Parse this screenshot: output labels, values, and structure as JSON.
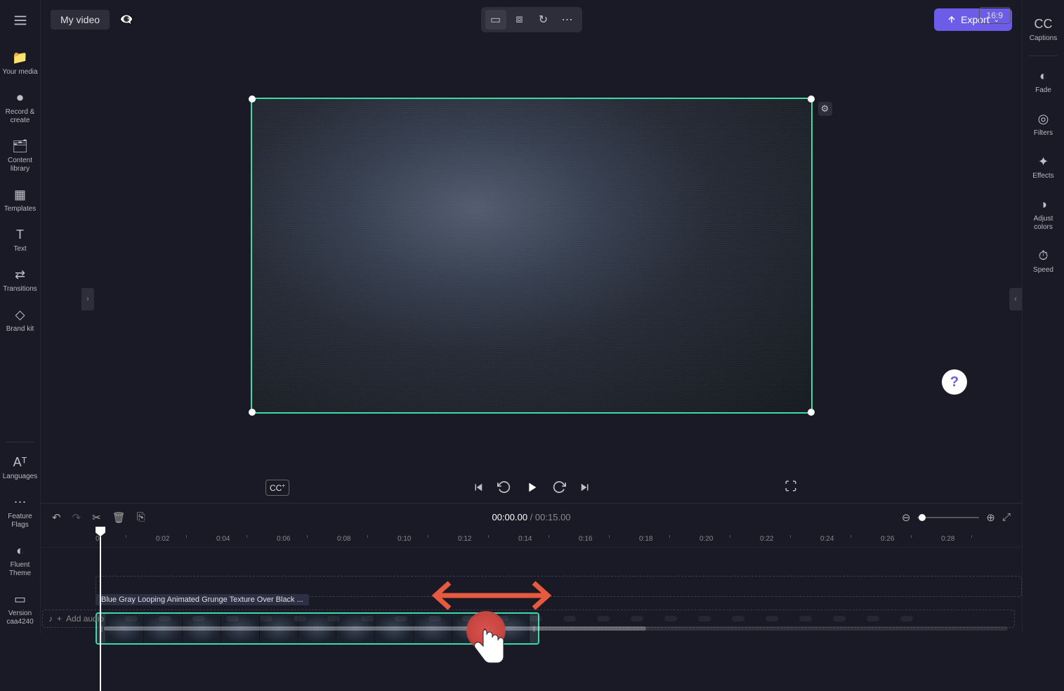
{
  "project_title": "My video",
  "export_label": "Export",
  "aspect_ratio": "16:9",
  "left_sidebar": [
    {
      "icon": "folder-icon",
      "label": "Your media"
    },
    {
      "icon": "record-icon",
      "label": "Record & create"
    },
    {
      "icon": "library-icon",
      "label": "Content library"
    },
    {
      "icon": "templates-icon",
      "label": "Templates"
    },
    {
      "icon": "text-icon",
      "label": "Text"
    },
    {
      "icon": "transitions-icon",
      "label": "Transitions"
    },
    {
      "icon": "brand-icon",
      "label": "Brand kit"
    }
  ],
  "left_sidebar_lower": [
    {
      "icon": "languages-icon",
      "label": "Languages"
    },
    {
      "icon": "flags-icon",
      "label": "Feature Flags"
    },
    {
      "icon": "theme-icon",
      "label": "Fluent Theme"
    },
    {
      "icon": "version-icon",
      "label": "Version caa4240"
    }
  ],
  "right_sidebar": [
    {
      "icon": "captions-icon",
      "label": "Captions"
    },
    {
      "icon": "fade-icon",
      "label": "Fade"
    },
    {
      "icon": "filters-icon",
      "label": "Filters"
    },
    {
      "icon": "effects-icon",
      "label": "Effects"
    },
    {
      "icon": "adjust-icon",
      "label": "Adjust colors"
    },
    {
      "icon": "speed-icon",
      "label": "Speed"
    }
  ],
  "timecode": {
    "current": "00:00.00",
    "duration": "00:15.00"
  },
  "ruler_ticks": [
    "0",
    "0:02",
    "0:04",
    "0:06",
    "0:08",
    "0:10",
    "0:12",
    "0:14",
    "0:16",
    "0:18",
    "0:20",
    "0:22",
    "0:24",
    "0:26",
    "0:28"
  ],
  "clip_title": "Blue Gray Looping Animated Grunge Texture Over Black ...",
  "add_audio_label": "Add audio",
  "help_label": "?",
  "colors": {
    "accent": "#6c5ce7",
    "selection": "#3fd9a8",
    "annotation": "#e85a3f"
  }
}
